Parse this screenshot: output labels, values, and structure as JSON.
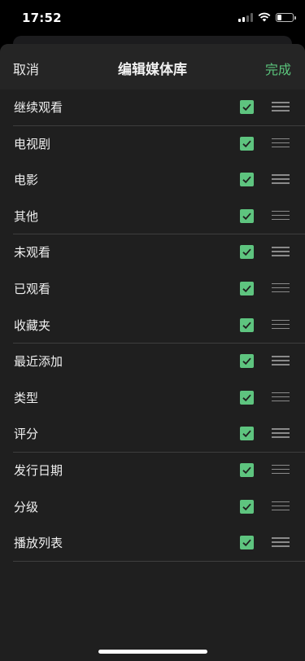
{
  "status_bar": {
    "time": "17:52"
  },
  "nav": {
    "cancel": "取消",
    "title": "编辑媒体库",
    "done": "完成"
  },
  "rows": [
    {
      "label": "继续观看",
      "checked": true
    },
    {
      "label": "电视剧",
      "checked": true
    },
    {
      "label": "电影",
      "checked": true
    },
    {
      "label": "其他",
      "checked": true
    },
    {
      "label": "未观看",
      "checked": true
    },
    {
      "label": "已观看",
      "checked": true
    },
    {
      "label": "收藏夹",
      "checked": true
    },
    {
      "label": "最近添加",
      "checked": true
    },
    {
      "label": "类型",
      "checked": true
    },
    {
      "label": "评分",
      "checked": true
    },
    {
      "label": "发行日期",
      "checked": true
    },
    {
      "label": "分级",
      "checked": true
    },
    {
      "label": "播放列表",
      "checked": true
    }
  ],
  "colors": {
    "accent": "#5bc47c",
    "checkbox": "#5ec47f",
    "sheet": "#1f1f1f",
    "nav": "#252525"
  }
}
